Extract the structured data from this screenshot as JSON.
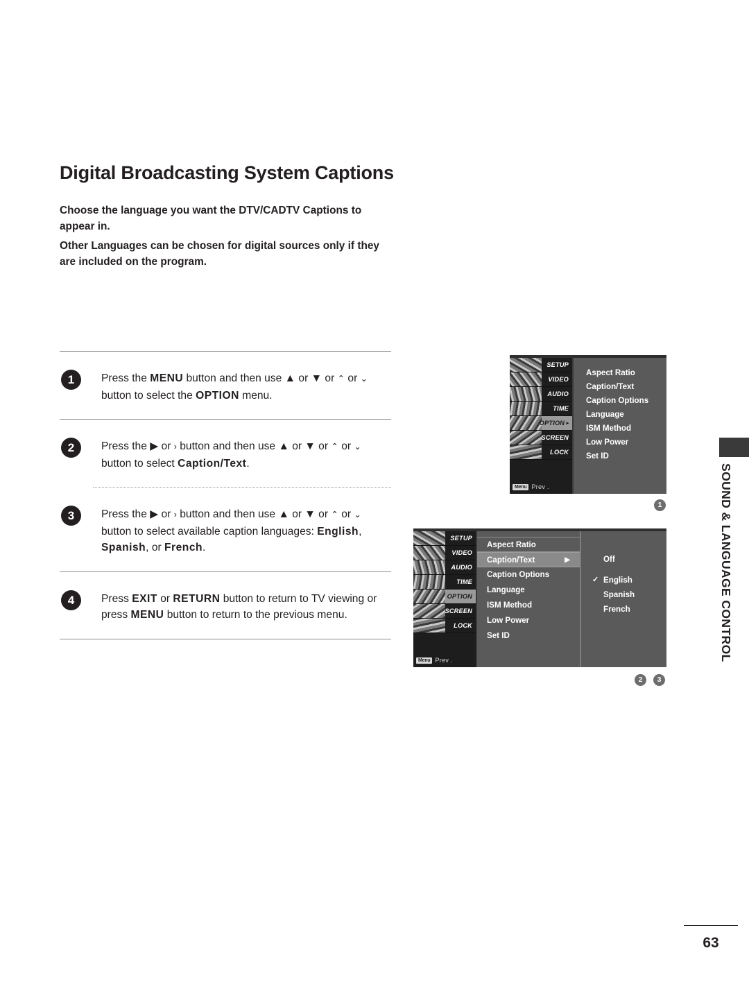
{
  "page": {
    "title": "Digital Broadcasting System Captions",
    "number": "63",
    "side_tab_label": "SOUND & LANGUAGE CONTROL"
  },
  "intro": {
    "paragraph_1": "Choose the language you want the DTV/CADTV Captions to appear in.",
    "paragraph_2": "Other Languages can be chosen for digital sources only if they are included on the program."
  },
  "steps": [
    {
      "badge": "1",
      "parts": [
        {
          "t": "Press the ",
          "b": false
        },
        {
          "t": "MENU",
          "b": true
        },
        {
          "t": " button and then use ",
          "b": false
        },
        {
          "t": "▲",
          "b": false
        },
        {
          "t": " or ",
          "b": false
        },
        {
          "t": "▼",
          "b": false
        },
        {
          "t": "  or  ",
          "b": false
        },
        {
          "t": "⌃",
          "b": false
        },
        {
          "t": " or ",
          "b": false
        },
        {
          "t": "⌄",
          "b": false
        },
        {
          "t": "  button to select the ",
          "b": false
        },
        {
          "t": "OPTION",
          "b": true
        },
        {
          "t": " menu.",
          "b": false
        }
      ]
    },
    {
      "badge": "2",
      "parts": [
        {
          "t": "Press the ",
          "b": false
        },
        {
          "t": "▶",
          "b": false
        },
        {
          "t": "  or  ",
          "b": false
        },
        {
          "t": "›",
          "b": false
        },
        {
          "t": "   button and then use ",
          "b": false
        },
        {
          "t": "▲",
          "b": false
        },
        {
          "t": " or ",
          "b": false
        },
        {
          "t": "▼",
          "b": false
        },
        {
          "t": "  or  ",
          "b": false
        },
        {
          "t": "⌃",
          "b": false
        },
        {
          "t": " or ",
          "b": false
        },
        {
          "t": "⌄",
          "b": false
        },
        {
          "t": "  button to select ",
          "b": false
        },
        {
          "t": "Caption/Text",
          "b": true
        },
        {
          "t": ".",
          "b": false
        }
      ]
    },
    {
      "badge": "3",
      "parts": [
        {
          "t": "Press the ",
          "b": false
        },
        {
          "t": "▶",
          "b": false
        },
        {
          "t": "  or  ",
          "b": false
        },
        {
          "t": "›",
          "b": false
        },
        {
          "t": "   button and then use ",
          "b": false
        },
        {
          "t": "▲",
          "b": false
        },
        {
          "t": " or ",
          "b": false
        },
        {
          "t": "▼",
          "b": false
        },
        {
          "t": "  or  ",
          "b": false
        },
        {
          "t": "⌃",
          "b": false
        },
        {
          "t": " or ",
          "b": false
        },
        {
          "t": "⌄",
          "b": false
        },
        {
          "t": "  button to select available caption languages: ",
          "b": false
        },
        {
          "t": "English",
          "b": true
        },
        {
          "t": ", ",
          "b": false
        },
        {
          "t": "Spanish",
          "b": true
        },
        {
          "t": ", or ",
          "b": false
        },
        {
          "t": "French",
          "b": true
        },
        {
          "t": ".",
          "b": false
        }
      ]
    },
    {
      "badge": "4",
      "parts": [
        {
          "t": "Press ",
          "b": false
        },
        {
          "t": "EXIT",
          "b": true
        },
        {
          "t": " or ",
          "b": false
        },
        {
          "t": "RETURN",
          "b": true
        },
        {
          "t": " button to return to TV viewing or press ",
          "b": false
        },
        {
          "t": "MENU",
          "b": true
        },
        {
          "t": " button to return to the previous menu.",
          "b": false
        }
      ]
    }
  ],
  "osd": {
    "categories": [
      "SETUP",
      "VIDEO",
      "AUDIO",
      "TIME",
      "OPTION",
      "SCREEN",
      "LOCK"
    ],
    "prev_chip": "Menu",
    "prev_label": "Prev .",
    "menu_items": [
      "Aspect Ratio",
      "Caption/Text",
      "Caption Options",
      "Language",
      "ISM Method",
      "Low Power",
      "Set ID"
    ],
    "screen_1": {
      "selected_category": "OPTION",
      "category_arrow": "▸"
    },
    "screen_2": {
      "selected_category": "OPTION",
      "highlighted_item": "Caption/Text",
      "submenu_arrow": "▶",
      "values": [
        "Off",
        "English",
        "Spanish",
        "French"
      ],
      "checked_value": "English",
      "check_glyph": "✓"
    }
  },
  "callouts": {
    "screen_1": [
      "1"
    ],
    "screen_2": [
      "2",
      "3"
    ]
  },
  "colors": {
    "osd_background": "#5a5a5a",
    "osd_sidebar": "#1d1d1d",
    "osd_highlight": "#8a8a8a",
    "badge_dark": "#231f20",
    "callout_gray": "#6d6d6d",
    "tab_block": "#3a3a3a"
  }
}
